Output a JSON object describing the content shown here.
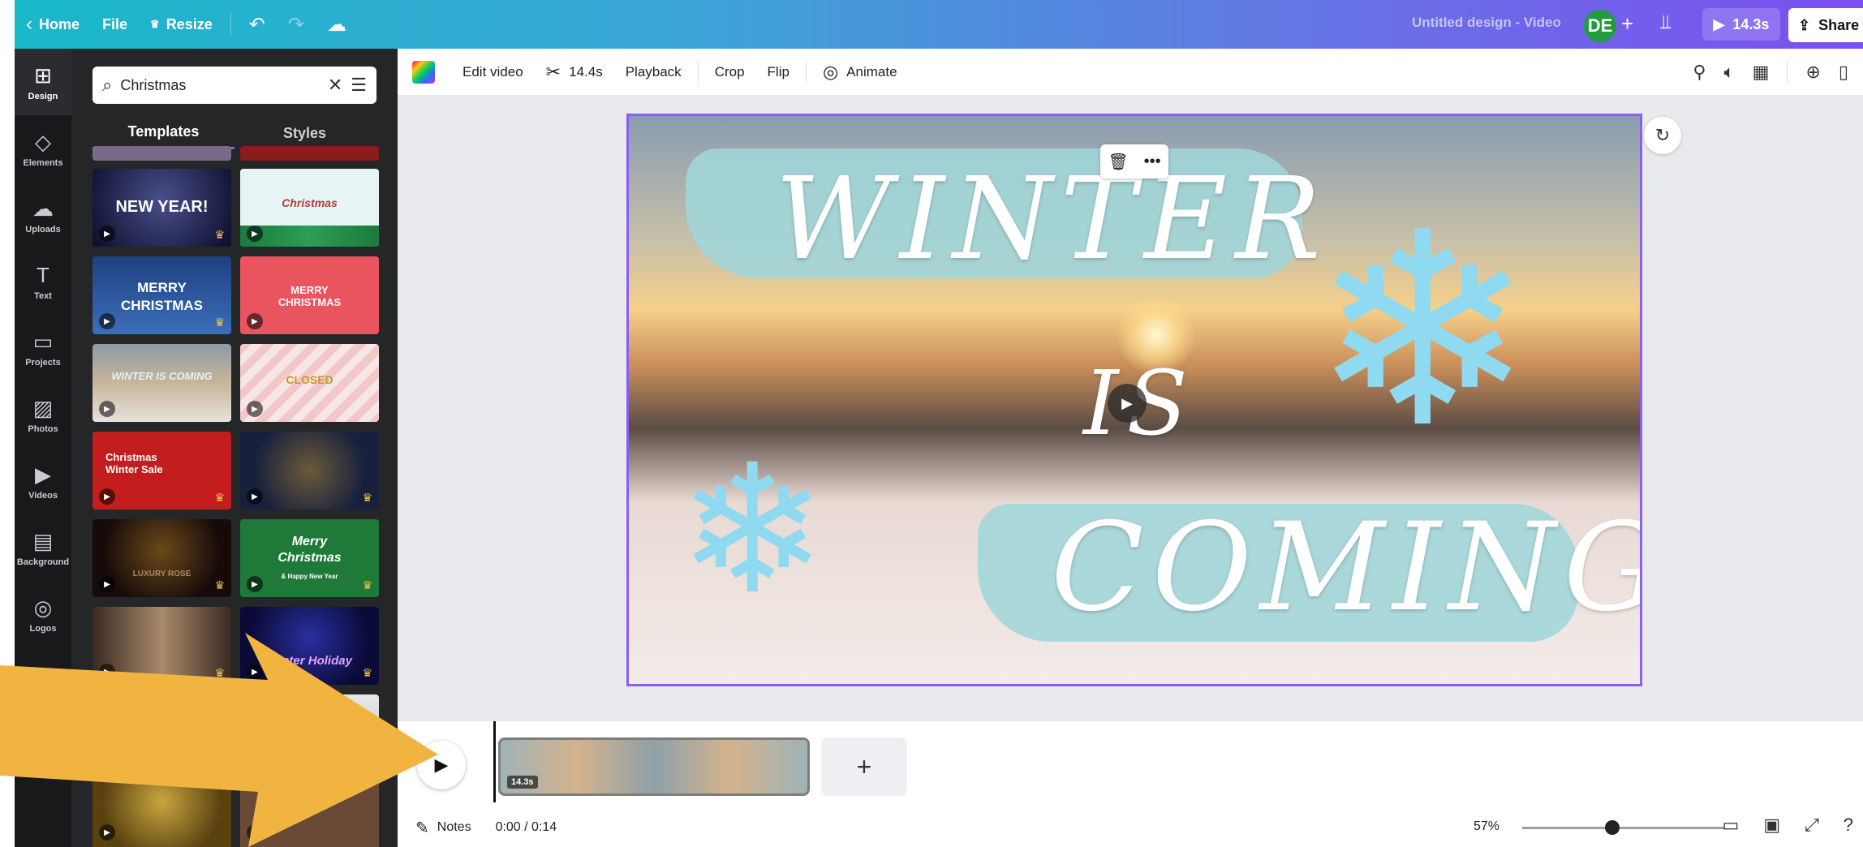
{
  "topbar": {
    "home": "Home",
    "file": "File",
    "resize": "Resize",
    "title": "Untitled design - Video",
    "avatar": "DE",
    "duration": "14.3s",
    "share": "Share"
  },
  "rail": [
    {
      "label": "Design",
      "icon": "⊞"
    },
    {
      "label": "Elements",
      "icon": "◇"
    },
    {
      "label": "Uploads",
      "icon": "☁"
    },
    {
      "label": "Text",
      "icon": "T"
    },
    {
      "label": "Projects",
      "icon": "▭"
    },
    {
      "label": "Photos",
      "icon": "▨"
    },
    {
      "label": "Videos",
      "icon": "▶"
    },
    {
      "label": "Background",
      "icon": "▤"
    },
    {
      "label": "Logos",
      "icon": "◎"
    }
  ],
  "panel": {
    "search_value": "Christmas",
    "tab_templates": "Templates",
    "tab_styles": "Styles",
    "thumbs": {
      "t1": "NEW YEAR!",
      "t2": "Christmas",
      "t3": "MERRY CHRISTMAS",
      "t4": "MERRY CHRISTMAS",
      "t5": "WINTER IS COMING",
      "t6": "CLOSED",
      "t7": "Christmas Winter Sale",
      "t9": "LUXURY ROSE",
      "t10": "Merry Christmas",
      "t10b": "& Happy New Year",
      "t12": "Winter Holiday"
    }
  },
  "toolbar": {
    "edit_video": "Edit video",
    "trim": "14.4s",
    "playback": "Playback",
    "crop": "Crop",
    "flip": "Flip",
    "animate": "Animate"
  },
  "canvas": {
    "word1": "WINTER",
    "word2": "IS",
    "word3": "COMING"
  },
  "timeline": {
    "clip_label": "14.3s",
    "add": "+"
  },
  "footer": {
    "notes": "Notes",
    "time": "0:00 / 0:14",
    "zoom": "57%"
  },
  "colors": {
    "accent": "#8b5cf6",
    "arrow": "#f2b441"
  }
}
